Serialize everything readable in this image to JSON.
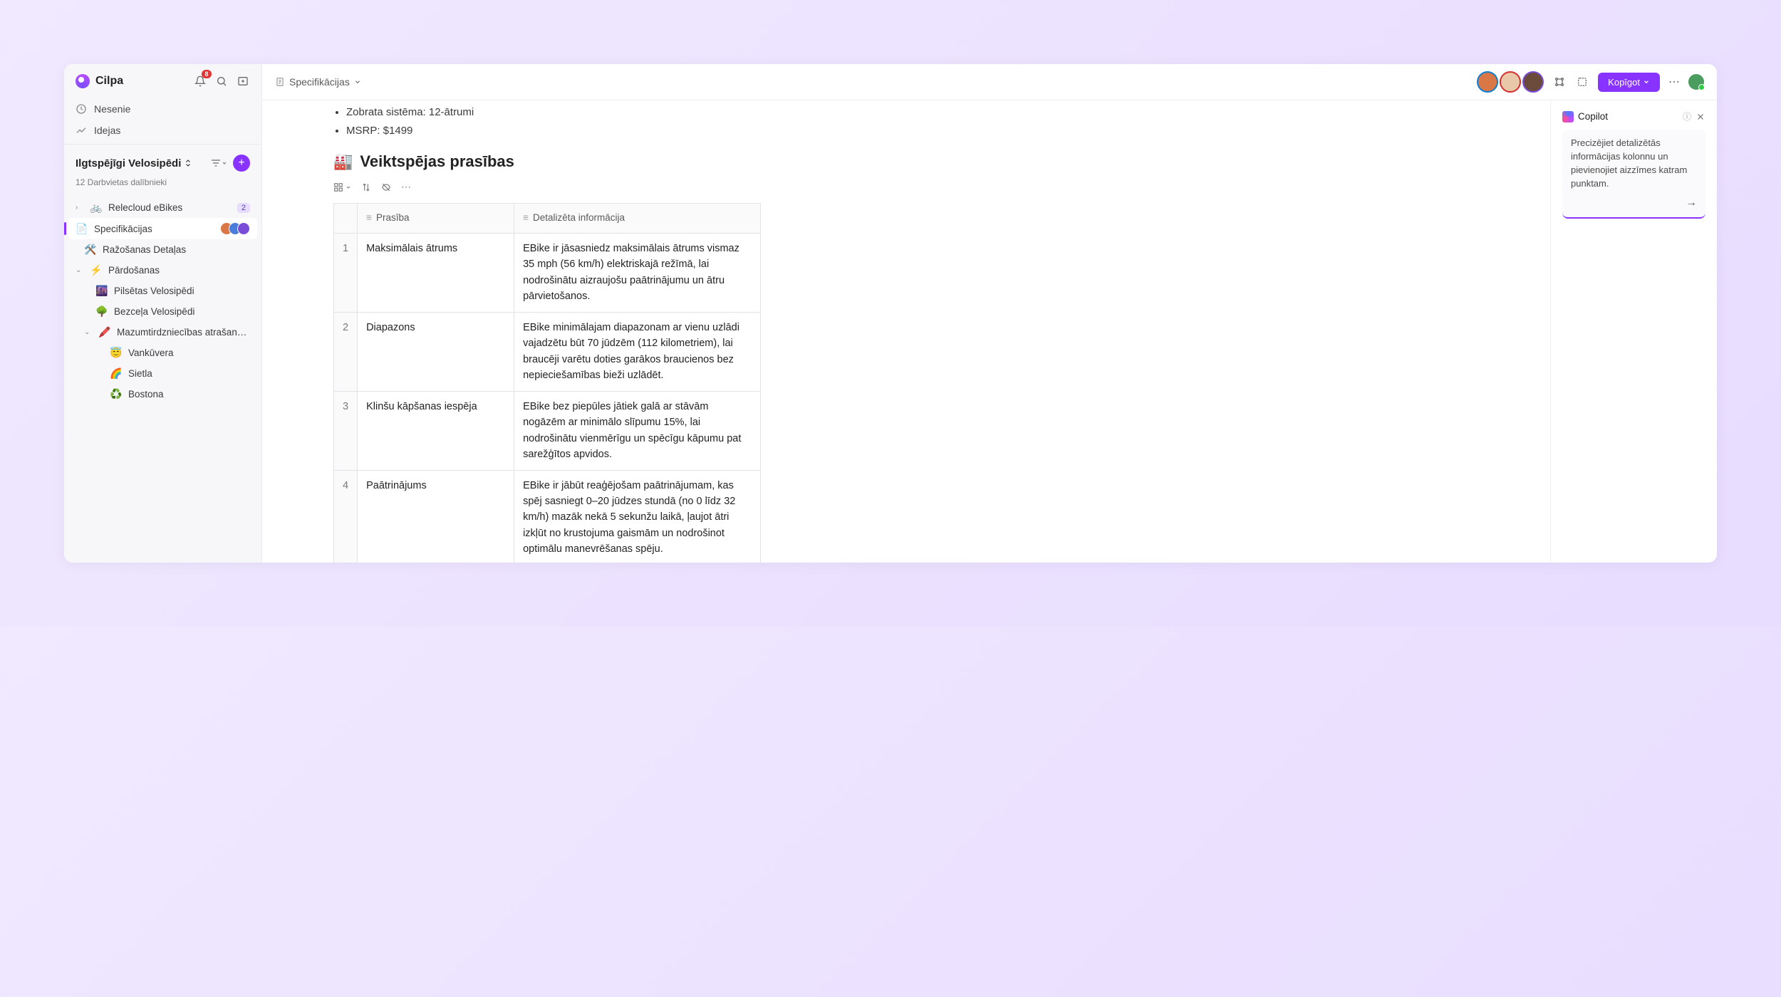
{
  "brand": "Cilpa",
  "notifications_count": "8",
  "nav": {
    "recent": "Nesenie",
    "ideas": "Idejas"
  },
  "workspace": {
    "title": "Ilgtspējīgi Velosipēdi",
    "subtitle": "12 Darbvietas dalībnieki"
  },
  "tree": {
    "item0": {
      "label": "Relecloud eBikes",
      "badge": "2"
    },
    "item1": {
      "label": "Specifikācijas"
    },
    "item2": {
      "label": "Ražošanas Detaļas"
    },
    "item3": {
      "label": "Pārdošanas"
    },
    "item4": {
      "label": "Pilsētas Velosipēdi"
    },
    "item5": {
      "label": "Bezceļa Velosipēdi"
    },
    "item6": {
      "label": "Mazumtirdzniecības atrašanās vi..."
    },
    "item7": {
      "label": "Vankūvera"
    },
    "item8": {
      "label": "Sietla"
    },
    "item9": {
      "label": "Bostona"
    }
  },
  "breadcrumb": "Specifikācijas",
  "share_label": "Kopīgot",
  "doc": {
    "bullet1": "Zobrata sistēma: 12-ātrumi",
    "bullet2": "MSRP: $1499",
    "heading": "Veiktspējas prasības"
  },
  "table": {
    "col1": "Prasība",
    "col2": "Detalizēta informācija",
    "rows": [
      {
        "n": "1",
        "name": "Maksimālais ātrums",
        "detail": "EBike ir jāsasniedz maksimālais ātrums vismaz 35 mph (56 km/h) elektriskajā režīmā, lai nodrošinātu aizraujošu paātrinājumu un ātru pārvietošanos."
      },
      {
        "n": "2",
        "name": "Diapazons",
        "detail": "EBike minimālajam diapazonam ar vienu uzlādi vajadzētu būt 70 jūdzēm (112 kilometriem), lai braucēji varētu doties garākos braucienos bez nepieciešamības bieži uzlādēt."
      },
      {
        "n": "3",
        "name": "Klinšu kāpšanas iespēja",
        "detail": "EBike bez piepūles jātiek galā ar stāvām nogāzēm ar minimālo slīpumu 15%, lai nodrošinātu vienmērīgu un spēcīgu kāpumu pat sarežģītos apvidos."
      },
      {
        "n": "4",
        "name": "Paātrinājums",
        "detail": "EBike ir jābūt reaģējošam paātrinājumam, kas spēj sasniegt 0–20 jūdzes stundā (no 0 līdz 32 km/h) mazāk nekā 5 sekunžu laikā, ļaujot ātri izkļūt no krustojuma gaismām un nodrošinot optimālu manevrēšanas spēju."
      }
    ]
  },
  "copilot": {
    "title": "Copilot",
    "message": "Precizējiet detalizētās informācijas kolonnu un pievienojiet aizzīmes katram punktam."
  }
}
